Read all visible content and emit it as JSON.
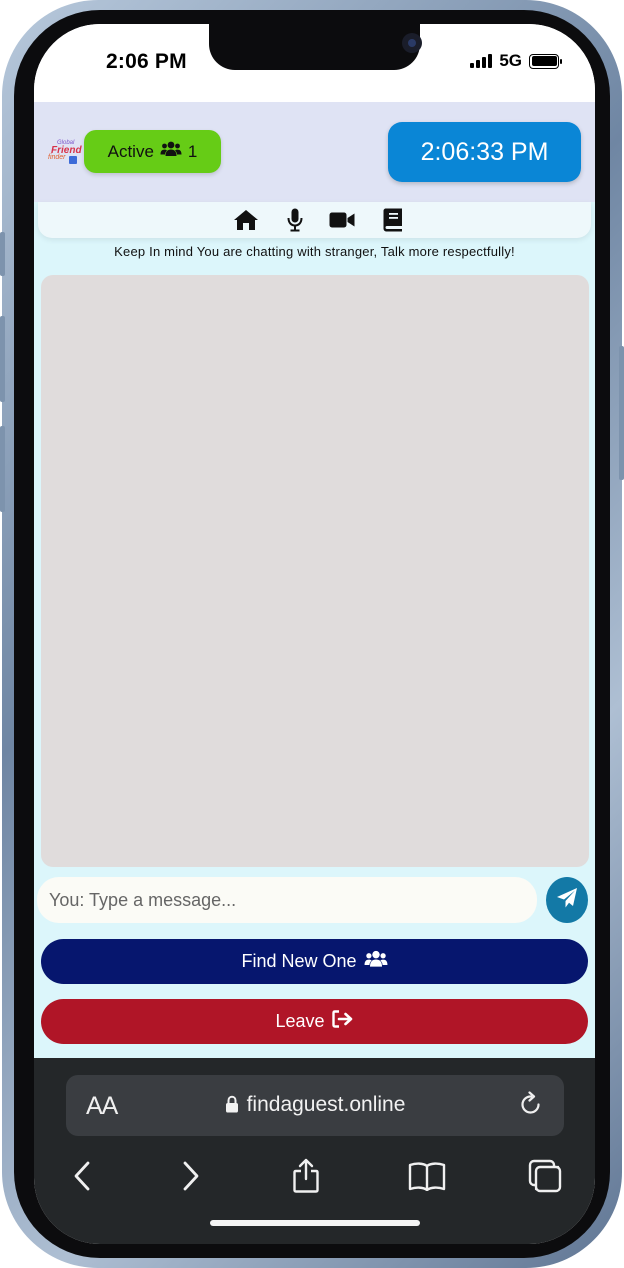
{
  "status_bar": {
    "time": "2:06 PM",
    "network": "5G",
    "signal_bars": 4,
    "battery_level": 1.0
  },
  "header": {
    "logo": {
      "line1": "Global",
      "line2": "Friend",
      "line3": "finder"
    },
    "active": {
      "label": "Active",
      "icon": "users-icon",
      "count": "1"
    },
    "clock": "2:06:33 PM"
  },
  "nav": {
    "icons": [
      "home-icon",
      "microphone-icon",
      "video-camera-icon",
      "book-icon"
    ]
  },
  "notice": "Keep In mind You are chatting with stranger, Talk more respectfully!",
  "chat": {
    "input_placeholder": "You: Type a message...",
    "send_icon": "paper-plane-icon"
  },
  "buttons": {
    "find_new": {
      "label": "Find New One",
      "icon": "users-icon",
      "color": "#06166e"
    },
    "leave": {
      "label": "Leave",
      "icon": "sign-out-icon",
      "color": "#b01527"
    }
  },
  "browser": {
    "text_size_label": "AA",
    "url": "findaguest.online",
    "toolbar_icons": [
      "back-icon",
      "forward-icon",
      "share-icon",
      "bookmarks-icon",
      "tabs-icon"
    ]
  },
  "colors": {
    "active_badge": "#66cc16",
    "clock_box": "#0a86d6",
    "send_button": "#1379a6",
    "header_bg": "#dfe3f4",
    "chat_area": "#e0dcdc"
  }
}
